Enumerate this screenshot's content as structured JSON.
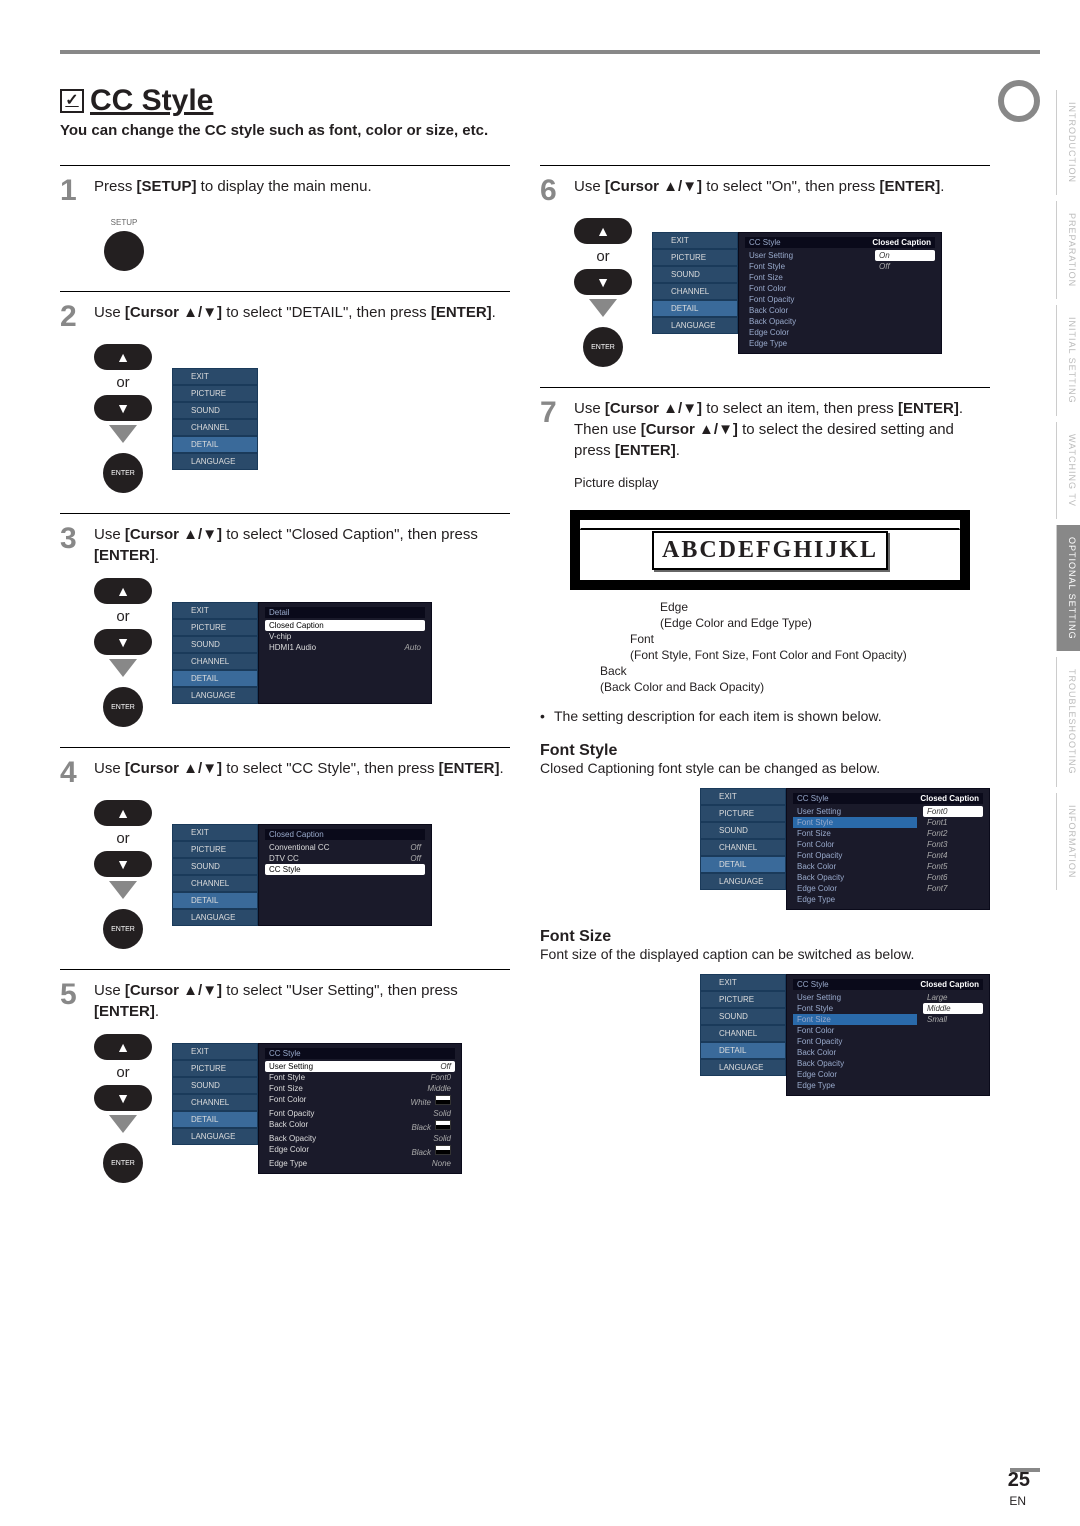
{
  "page": {
    "title": "CC Style",
    "intro": "You can change the CC style such as font, color or size, etc.",
    "page_number": "25",
    "lang": "EN"
  },
  "side_tabs": [
    "INTRODUCTION",
    "PREPARATION",
    "INITIAL SETTING",
    "WATCHING TV",
    "OPTIONAL SETTING",
    "TROUBLESHOOTING",
    "INFORMATION"
  ],
  "side_tab_active": 4,
  "labels": {
    "or": "or",
    "enter_btn": "ENTER",
    "setup": "SETUP",
    "picture_display": "Picture display",
    "sample": "ABCDEFGHIJKL"
  },
  "steps": {
    "s1": {
      "num": "1",
      "pre": "Press ",
      "b1": "[SETUP]",
      "post": " to display the main menu."
    },
    "s2": {
      "num": "2",
      "pre": "Use ",
      "b1": "[Cursor ▲/▼]",
      "mid": " to select \"DETAIL\", then press ",
      "b2": "[ENTER]",
      "post": "."
    },
    "s3": {
      "num": "3",
      "pre": "Use ",
      "b1": "[Cursor ▲/▼]",
      "mid": " to select \"Closed Caption\", then press ",
      "b2": "[ENTER]",
      "post": "."
    },
    "s4": {
      "num": "4",
      "pre": "Use ",
      "b1": "[Cursor ▲/▼]",
      "mid": " to select \"CC Style\", then press ",
      "b2": "[ENTER]",
      "post": "."
    },
    "s5": {
      "num": "5",
      "pre": "Use ",
      "b1": "[Cursor ▲/▼]",
      "mid": " to select \"User Setting\", then press ",
      "b2": "[ENTER]",
      "post": "."
    },
    "s6": {
      "num": "6",
      "pre": "Use ",
      "b1": "[Cursor ▲/▼]",
      "mid": " to select \"On\", then press ",
      "b2": "[ENTER]",
      "post": "."
    },
    "s7": {
      "num": "7",
      "pre": "Use ",
      "b1": "[Cursor ▲/▼]",
      "mid": " to select an item, then press ",
      "b2": "[ENTER]",
      "mid2": ". Then use ",
      "b3": "[Cursor ▲/▼]",
      "mid3": " to select the desired setting and press ",
      "b4": "[ENTER]",
      "post": "."
    }
  },
  "osd_menu_items": [
    "EXIT",
    "PICTURE",
    "SOUND",
    "CHANNEL",
    "DETAIL",
    "LANGUAGE"
  ],
  "osd2": {
    "title": "Detail",
    "rows": [
      {
        "l": "Closed Caption"
      },
      {
        "l": "V-chip"
      },
      {
        "l": "HDMI1 Audio",
        "r": "Auto"
      }
    ],
    "sel": 0
  },
  "osd4": {
    "title": "Closed Caption",
    "rows": [
      {
        "l": "Conventional CC",
        "r": "Off"
      },
      {
        "l": "DTV CC",
        "r": "Off"
      },
      {
        "l": "CC Style"
      }
    ],
    "sel": 2
  },
  "osd5": {
    "title": "CC Style",
    "rows": [
      {
        "l": "User Setting",
        "r": "Off"
      },
      {
        "l": "Font Style",
        "r": "Font0"
      },
      {
        "l": "Font Size",
        "r": "Middle"
      },
      {
        "l": "Font Color",
        "r": "White",
        "sw": true
      },
      {
        "l": "Font Opacity",
        "r": "Solid"
      },
      {
        "l": "Back Color",
        "r": "Black",
        "sw": true
      },
      {
        "l": "Back Opacity",
        "r": "Solid"
      },
      {
        "l": "Edge Color",
        "r": "Black",
        "sw": true
      },
      {
        "l": "Edge Type",
        "r": "None"
      }
    ],
    "sel": 0
  },
  "osd6": {
    "title": "CC Style",
    "title2": "Closed Caption",
    "rows": [
      {
        "l": "User Setting"
      },
      {
        "l": "Font Style"
      },
      {
        "l": "Font Size"
      },
      {
        "l": "Font Color"
      },
      {
        "l": "Font Opacity"
      },
      {
        "l": "Back Color"
      },
      {
        "l": "Back Opacity"
      },
      {
        "l": "Edge Color"
      },
      {
        "l": "Edge Type"
      }
    ],
    "options": [
      "On",
      "Off"
    ],
    "option_sel": 0
  },
  "callouts": {
    "edge": "Edge",
    "edge2": "(Edge Color and Edge Type)",
    "font": "Font",
    "font2": "(Font Style, Font Size, Font Color and Font Opacity)",
    "back": "Back",
    "back2": "(Back Color and Back Opacity)"
  },
  "note": "The setting description for each item is shown below.",
  "font_style": {
    "h": "Font Style",
    "p": "Closed Captioning font style can be changed as below.",
    "osd": {
      "title": "CC Style",
      "title2": "Closed Caption",
      "rows": [
        "User Setting",
        "Font Style",
        "Font Size",
        "Font Color",
        "Font Opacity",
        "Back Color",
        "Back Opacity",
        "Edge Color",
        "Edge Type"
      ],
      "options": [
        "Font0",
        "Font1",
        "Font2",
        "Font3",
        "Font4",
        "Font5",
        "Font6",
        "Font7"
      ],
      "sel_row": 1,
      "option_sel": 0
    }
  },
  "font_size": {
    "h": "Font Size",
    "p": "Font size of the displayed caption can be switched as below.",
    "osd": {
      "title": "CC Style",
      "title2": "Closed Caption",
      "rows": [
        "User Setting",
        "Font Style",
        "Font Size",
        "Font Color",
        "Font Opacity",
        "Back Color",
        "Back Opacity",
        "Edge Color",
        "Edge Type"
      ],
      "options": [
        "Large",
        "Middle",
        "Small"
      ],
      "sel_row": 2,
      "option_sel": 1
    }
  }
}
